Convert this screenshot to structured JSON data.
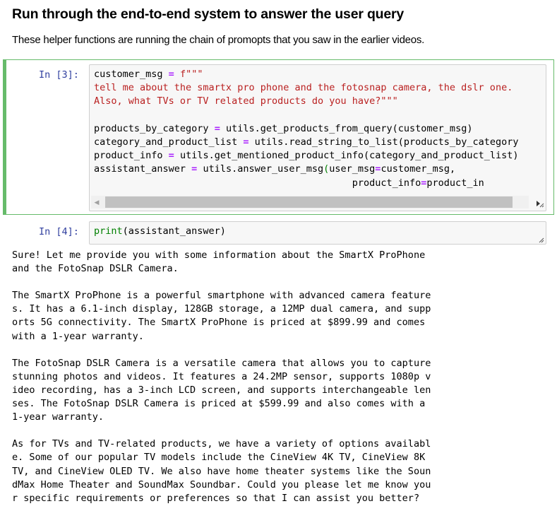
{
  "markdown": {
    "heading": "Run through the end-to-end system to answer the user query",
    "paragraph": "These helper functions are running the chain of promopts that you saw in the earlier videos."
  },
  "cells": {
    "cell3": {
      "prompt": "In [3]:",
      "code_lines": [
        [
          {
            "t": "customer_msg ",
            "c": ""
          },
          {
            "t": "=",
            "c": "op"
          },
          {
            "t": " f\"\"\"",
            "c": "str"
          }
        ],
        [
          {
            "t": "tell me about the smartx pro phone and the fotosnap camera, the dslr one.",
            "c": "str"
          }
        ],
        [
          {
            "t": "Also, what TVs or TV related products do you have?\"\"\"",
            "c": "str"
          }
        ],
        [
          {
            "t": "",
            "c": ""
          }
        ],
        [
          {
            "t": "products_by_category ",
            "c": ""
          },
          {
            "t": "=",
            "c": "op"
          },
          {
            "t": " utils.get_products_from_query(customer_msg)",
            "c": ""
          }
        ],
        [
          {
            "t": "category_and_product_list ",
            "c": ""
          },
          {
            "t": "=",
            "c": "op"
          },
          {
            "t": " utils.read_string_to_list(products_by_category",
            "c": ""
          }
        ],
        [
          {
            "t": "product_info ",
            "c": ""
          },
          {
            "t": "=",
            "c": "op"
          },
          {
            "t": " utils.get_mentioned_product_info(category_and_product_list)",
            "c": ""
          }
        ],
        [
          {
            "t": "assistant_answer ",
            "c": ""
          },
          {
            "t": "=",
            "c": "op"
          },
          {
            "t": " utils.answer_user_msg",
            "c": ""
          },
          {
            "t": "(",
            "c": "bracket-match"
          },
          {
            "t": "user_msg",
            "c": ""
          },
          {
            "t": "=",
            "c": "op"
          },
          {
            "t": "customer_msg,",
            "c": ""
          }
        ],
        [
          {
            "t": "                                             product_info",
            "c": ""
          },
          {
            "t": "=",
            "c": "op"
          },
          {
            "t": "product_in",
            "c": ""
          }
        ]
      ],
      "scrollbar": {
        "left_arrow": "◀",
        "right_arrow": "▶"
      }
    },
    "cell4": {
      "prompt": "In [4]:",
      "code_lines": [
        [
          {
            "t": "print",
            "c": "builtin"
          },
          {
            "t": "(assistant_answer)",
            "c": ""
          }
        ]
      ],
      "output_lines": [
        "Sure! Let me provide you with some information about the SmartX ProPhone",
        "and the FotoSnap DSLR Camera.",
        "",
        "The SmartX ProPhone is a powerful smartphone with advanced camera feature",
        "s. It has a 6.1-inch display, 128GB storage, a 12MP dual camera, and supp",
        "orts 5G connectivity. The SmartX ProPhone is priced at $899.99 and comes",
        "with a 1-year warranty.",
        "",
        "The FotoSnap DSLR Camera is a versatile camera that allows you to capture",
        "stunning photos and videos. It features a 24.2MP sensor, supports 1080p v",
        "ideo recording, has a 3-inch LCD screen, and supports interchangeable len",
        "ses. The FotoSnap DSLR Camera is priced at $599.99 and also comes with a",
        "1-year warranty.",
        "",
        "As for TVs and TV-related products, we have a variety of options availabl",
        "e. Some of our popular TV models include the CineView 4K TV, CineView 8K",
        "TV, and CineView OLED TV. We also have home theater systems like the Soun",
        "dMax Home Theater and SoundMax Soundbar. Could you please let me know you",
        "r specific requirements or preferences so that I can assist you better?"
      ]
    }
  },
  "colors": {
    "selected_border": "#66bb6a",
    "prompt": "#303f9f",
    "string": "#ba2121",
    "operator": "#aa22ff",
    "builtin": "#008000",
    "input_bg": "#f7f7f7"
  },
  "icons": {
    "resize_grip": "resize-grip-icon",
    "scroll_left": "scroll-left-arrow-icon",
    "scroll_right": "scroll-right-arrow-icon"
  }
}
